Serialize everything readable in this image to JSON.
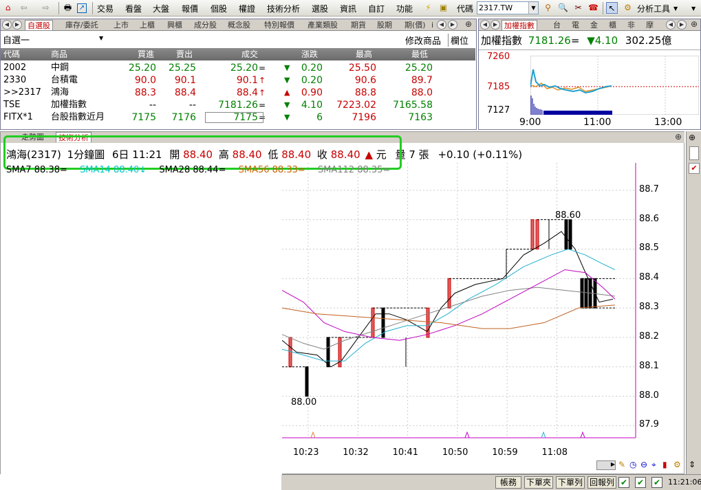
{
  "menu": {
    "items": [
      "交易",
      "看盤",
      "大盤",
      "報價",
      "個股",
      "權證",
      "技術分析",
      "選股",
      "資訊",
      "自訂",
      "功能"
    ],
    "code_label": "代碼",
    "code_value": "2317.TW",
    "analysis_tool": "分析工具"
  },
  "quote_panel": {
    "tabs": [
      "自選股",
      "庫存/委託",
      "上市",
      "上櫃",
      "興櫃",
      "成分股",
      "概念股",
      "特別報價",
      "產業類股",
      "期貨",
      "股期",
      "期(價)",
      "i"
    ],
    "group_name": "自選一",
    "edit_button": "修改商品",
    "field_button": "欄位",
    "headers": [
      "代碼",
      "商品",
      "買進",
      "賣出",
      "成交",
      "漲跌",
      "最高",
      "最低"
    ],
    "rows": [
      {
        "code": "2002",
        "name": "中鋼",
        "bid": "25.20",
        "ask": "25.25",
        "last": "25.20",
        "flag": "=",
        "dir": "down",
        "chg": "0.20",
        "high": "25.50",
        "low": "25.20",
        "color": "grn"
      },
      {
        "code": "2330",
        "name": "台積電",
        "bid": "90.0",
        "ask": "90.1",
        "last": "90.1",
        "flag": "↑",
        "dir": "down",
        "chg": "0.20",
        "high": "90.6",
        "low": "89.7",
        "color": "red"
      },
      {
        "code": ">>2317",
        "name": "鴻海",
        "bid": "88.3",
        "ask": "88.4",
        "last": "88.4",
        "flag": "↑",
        "dir": "up",
        "chg": "0.90",
        "high": "88.8",
        "low": "88.0",
        "color": "red"
      },
      {
        "code": "TSE",
        "name": "加權指數",
        "bid": "--",
        "ask": "--",
        "last": "7181.26",
        "flag": "=",
        "dir": "down",
        "chg": "4.10",
        "high": "7223.02",
        "low": "7165.58",
        "color": "grn"
      },
      {
        "code": "FITX*1",
        "name": "台股指數近月",
        "bid": "7175",
        "ask": "7176",
        "last": "7175",
        "flag": "=",
        "dir": "down",
        "chg": "6",
        "high": "7196",
        "low": "7163",
        "color": "grn"
      }
    ]
  },
  "index_panel": {
    "tabs": [
      "加權指數",
      "台",
      "電",
      "金",
      "櫃",
      "非",
      "摩"
    ],
    "title": "加權指數",
    "value": "7181.26",
    "flag": "=",
    "change": "▼4.10",
    "volume": "302.25億",
    "y_labels": [
      "7260",
      "7185",
      "7127"
    ],
    "x_labels": [
      "9:00",
      "11:00",
      "13:00"
    ]
  },
  "chart_panel": {
    "tabs": [
      "走勢圖",
      "技術分析"
    ],
    "info": {
      "stock": "鴻海(2317)",
      "period": "1分鐘圖",
      "datetime": "6日 11:21",
      "open_label": "開",
      "open": "88.40",
      "high_label": "高",
      "high": "88.40",
      "low_label": "低",
      "low": "88.40",
      "close_label": "收",
      "close": "88.40",
      "unit": "元",
      "vol": "量 7 張",
      "change": "+0.10 (+0.11%)"
    },
    "ma_legend": [
      {
        "text": "SMA7 88.38=",
        "color": "#000000"
      },
      {
        "text": "SMA14 88.40↓",
        "color": "#00c8c8"
      },
      {
        "text": "SMA28 88.44=",
        "color": "#000000"
      },
      {
        "text": "SMA56 88.33=",
        "color": "#c86400"
      },
      {
        "text": "SMA112 88.35=",
        "color": "#808080"
      }
    ],
    "annotations": {
      "peak": "88.60",
      "trough": "88.00"
    }
  },
  "chart_data": {
    "type": "candlestick",
    "y_ticks": [
      "88.7",
      "88.6",
      "88.5",
      "88.4",
      "88.3",
      "88.2",
      "88.1",
      "88.0",
      "87.9"
    ],
    "x_ticks": [
      "10:23",
      "10:32",
      "10:41",
      "10:50",
      "10:59",
      "11:08"
    ],
    "ylim": [
      87.88,
      88.73
    ]
  },
  "status": {
    "buttons": [
      "帳務",
      "下單夾",
      "下單列",
      "回報列"
    ],
    "time": "11:21:06"
  },
  "colors": {
    "accent": "#c00000",
    "up": "#c80000",
    "down": "#008000",
    "highlight_box": "#22cc22"
  }
}
